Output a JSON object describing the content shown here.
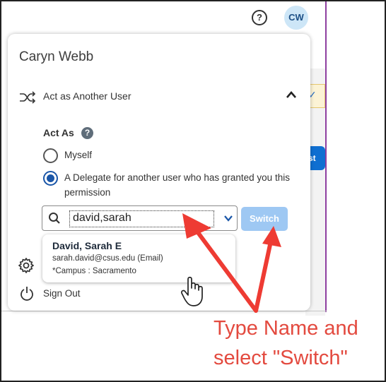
{
  "header": {
    "help_icon_glyph": "?",
    "avatar_initials": "CW"
  },
  "background": {
    "partial_button_text": "st",
    "partial_check": "✓"
  },
  "menu": {
    "user_name": "Caryn Webb",
    "act_as_another_user_label": "Act as Another User",
    "act_as_title": "Act As",
    "act_as_help_glyph": "?",
    "options": [
      {
        "label": "Myself",
        "selected": false
      },
      {
        "label": "A Delegate for another user who has granted you this permission",
        "selected": true
      }
    ],
    "search": {
      "value": "david,sarah"
    },
    "switch_button_label": "Switch",
    "suggestion": {
      "name": "David, Sarah E",
      "email": "sarah.david@csus.edu (Email)",
      "campus": "*Campus : Sacramento"
    },
    "sign_out_label": "Sign Out"
  },
  "annotation": {
    "line1": "Type Name and",
    "line2": "select \"Switch\"",
    "color": "#e34a3f"
  },
  "colors": {
    "primary": "#1a56a8",
    "switch_disabled": "#9ec8f3",
    "avatar_bg": "#cde6f7",
    "divider": "#8e3fa0"
  }
}
